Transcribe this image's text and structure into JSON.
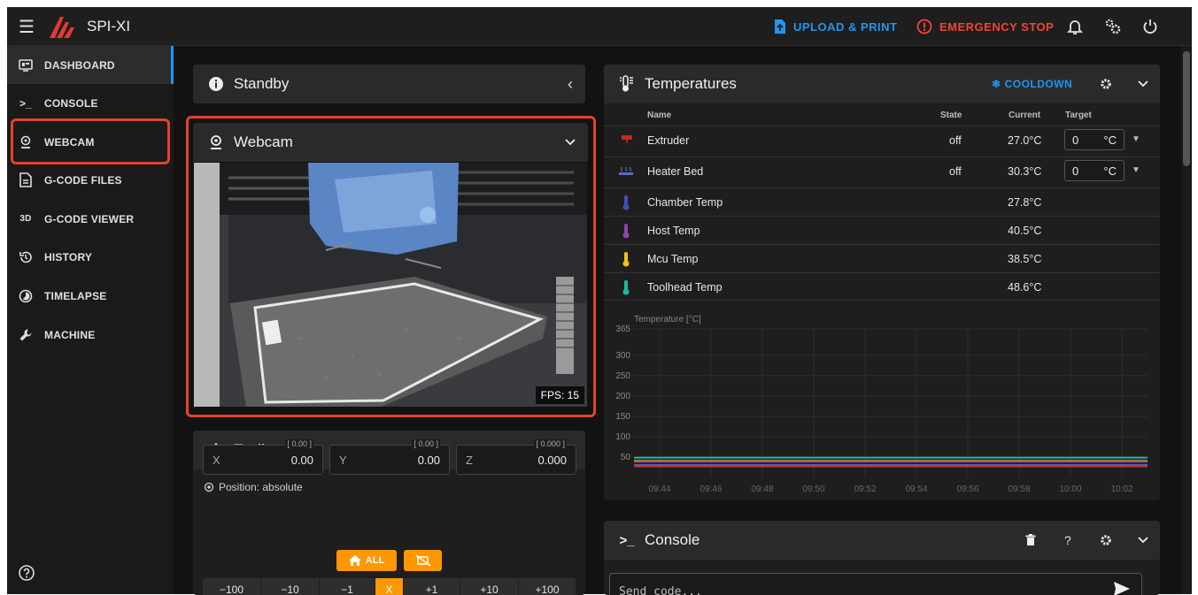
{
  "app": {
    "title": "SPI-XI"
  },
  "topbar": {
    "upload_label": "UPLOAD & PRINT",
    "estop_label": "EMERGENCY STOP",
    "accent_blue": "#2196f3",
    "accent_red": "#f44336"
  },
  "sidebar": {
    "items": [
      {
        "label": "DASHBOARD",
        "icon": "monitor-dashboard-icon",
        "active": true
      },
      {
        "label": "CONSOLE",
        "icon": "console-icon"
      },
      {
        "label": "WEBCAM",
        "icon": "webcam-icon",
        "highlighted": true
      },
      {
        "label": "G-CODE FILES",
        "icon": "file-document-icon"
      },
      {
        "label": "G-CODE VIEWER",
        "icon": "3d-icon",
        "icon_text": "3D"
      },
      {
        "label": "HISTORY",
        "icon": "history-icon"
      },
      {
        "label": "TIMELAPSE",
        "icon": "timelapse-icon"
      },
      {
        "label": "MACHINE",
        "icon": "wrench-icon"
      }
    ]
  },
  "standby": {
    "title": "Standby"
  },
  "webcam": {
    "title": "Webcam",
    "fps": "FPS: 15"
  },
  "toolhead": {
    "title": "Toolhead",
    "position_label": "Position: absolute",
    "axes": [
      {
        "label": "X",
        "value": "0.00",
        "sub": "[ 0.00 ]"
      },
      {
        "label": "Y",
        "value": "0.00",
        "sub": "[ 0.00 ]"
      },
      {
        "label": "Z",
        "value": "0.000",
        "sub": "[ 0.000 ]"
      }
    ],
    "home_all_label": "ALL",
    "jog_buttons": [
      "−100",
      "−10",
      "−1",
      "X",
      "+1",
      "+10",
      "+100"
    ]
  },
  "temperatures": {
    "title": "Temperatures",
    "cooldown_label": "COOLDOWN",
    "headers": {
      "name": "Name",
      "state": "State",
      "current": "Current",
      "target": "Target"
    },
    "rows": [
      {
        "name": "Extruder",
        "state": "off",
        "current": "27.0°C",
        "target": "0",
        "unit": "°C",
        "icon": "extruder-icon",
        "color": "#c62828"
      },
      {
        "name": "Heater Bed",
        "state": "off",
        "current": "30.3°C",
        "target": "0",
        "unit": "°C",
        "icon": "heater-bed-icon",
        "color": "#5c6bc0"
      },
      {
        "name": "Chamber Temp",
        "state": "",
        "current": "27.8°C",
        "icon": "thermometer-icon",
        "color": "#3f51b5"
      },
      {
        "name": "Host Temp",
        "state": "",
        "current": "40.5°C",
        "icon": "thermometer-icon",
        "color": "#8e44ad"
      },
      {
        "name": "Mcu Temp",
        "state": "",
        "current": "38.5°C",
        "icon": "thermometer-icon",
        "color": "#f1c40f"
      },
      {
        "name": "Toolhead Temp",
        "state": "",
        "current": "48.6°C",
        "icon": "thermometer-icon",
        "color": "#1abc9c"
      }
    ]
  },
  "chart_data": {
    "type": "line",
    "ylabel": "Temperature [°C]",
    "ylim": [
      0,
      365
    ],
    "y_ticks": [
      50,
      100,
      150,
      200,
      250,
      300,
      365
    ],
    "x": [
      "09:44",
      "09:46",
      "09:48",
      "09:50",
      "09:52",
      "09:54",
      "09:56",
      "09:58",
      "10:00",
      "10:02"
    ],
    "grid": true,
    "series": [
      {
        "color": "#1abc9c",
        "values": [
          48.6,
          48.6,
          48.6,
          48.6,
          48.6,
          48.6,
          48.6,
          48.6,
          48.6,
          48.6
        ]
      },
      {
        "color": "#f1c40f",
        "values": [
          40.5,
          40.5,
          40.5,
          40.5,
          40.5,
          40.5,
          40.5,
          40.5,
          40.5,
          40.5
        ]
      },
      {
        "color": "#8e44ad",
        "values": [
          38.5,
          38.5,
          38.5,
          38.5,
          38.5,
          38.5,
          38.5,
          38.5,
          38.5,
          38.5
        ]
      },
      {
        "color": "#5c6bc0",
        "values": [
          30.3,
          30.3,
          30.3,
          30.3,
          30.3,
          30.3,
          30.3,
          30.3,
          30.3,
          30.3
        ]
      },
      {
        "color": "#c62828",
        "values": [
          27.0,
          27.0,
          27.0,
          27.0,
          27.0,
          27.0,
          27.0,
          27.0,
          27.0,
          27.0
        ]
      }
    ]
  },
  "console": {
    "title": "Console",
    "placeholder": "Send code..."
  }
}
